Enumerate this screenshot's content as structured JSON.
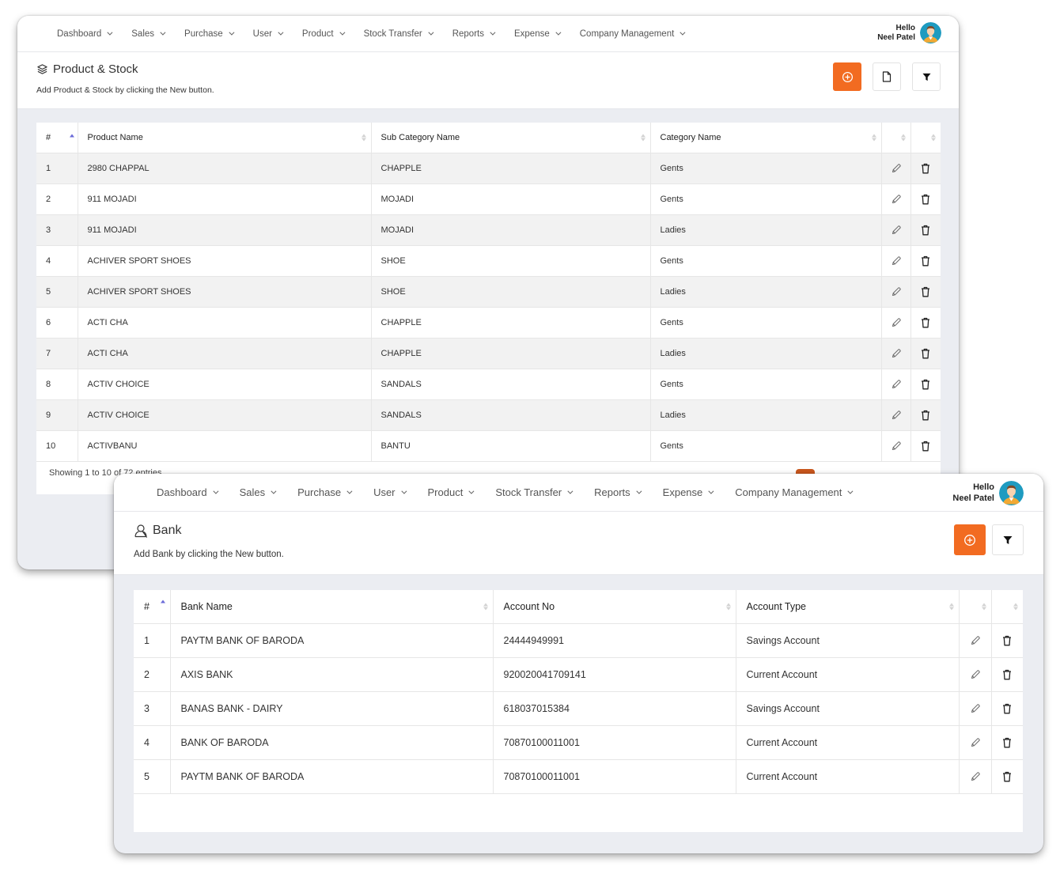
{
  "windows": {
    "product": {
      "nav": {
        "items": [
          {
            "label": "Dashboard"
          },
          {
            "label": "Sales"
          },
          {
            "label": "Purchase"
          },
          {
            "label": "User"
          },
          {
            "label": "Product"
          },
          {
            "label": "Stock Transfer"
          },
          {
            "label": "Reports"
          },
          {
            "label": "Expense"
          },
          {
            "label": "Company Management"
          }
        ],
        "user": {
          "greeting": "Hello",
          "name": "Neel Patel"
        }
      },
      "header": {
        "title": "Product & Stock",
        "title_icon": "layers-icon",
        "subtitle": "Add Product & Stock by clicking the New button.",
        "actions": [
          {
            "name": "new-button",
            "icon": "plus-circle-icon"
          },
          {
            "name": "export-button",
            "icon": "document-icon"
          },
          {
            "name": "filter-button",
            "icon": "filter-icon"
          }
        ]
      },
      "table": {
        "columns": [
          "#",
          "Product Name",
          "Sub Category Name",
          "Category Name",
          "",
          ""
        ],
        "rows": [
          {
            "no": "1",
            "product": "2980 CHAPPAL",
            "sub_category": "CHAPPLE",
            "category": "Gents"
          },
          {
            "no": "2",
            "product": "911 MOJADI",
            "sub_category": "MOJADI",
            "category": "Gents"
          },
          {
            "no": "3",
            "product": "911 MOJADI",
            "sub_category": "MOJADI",
            "category": "Ladies"
          },
          {
            "no": "4",
            "product": "ACHIVER SPORT SHOES",
            "sub_category": "SHOE",
            "category": "Gents"
          },
          {
            "no": "5",
            "product": "ACHIVER SPORT SHOES",
            "sub_category": "SHOE",
            "category": "Ladies"
          },
          {
            "no": "6",
            "product": "ACTI CHA",
            "sub_category": "CHAPPLE",
            "category": "Gents"
          },
          {
            "no": "7",
            "product": "ACTI CHA",
            "sub_category": "CHAPPLE",
            "category": "Ladies"
          },
          {
            "no": "8",
            "product": "ACTIV CHOICE",
            "sub_category": "SANDALS",
            "category": "Gents"
          },
          {
            "no": "9",
            "product": "ACTIV CHOICE",
            "sub_category": "SANDALS",
            "category": "Ladies"
          },
          {
            "no": "10",
            "product": "ACTIVBANU",
            "sub_category": "BANTU",
            "category": "Gents"
          }
        ],
        "footer": "Showing 1 to 10 of 72 entries"
      }
    },
    "bank": {
      "nav": {
        "items": [
          {
            "label": "Dashboard"
          },
          {
            "label": "Sales"
          },
          {
            "label": "Purchase"
          },
          {
            "label": "User"
          },
          {
            "label": "Product"
          },
          {
            "label": "Stock Transfer"
          },
          {
            "label": "Reports"
          },
          {
            "label": "Expense"
          },
          {
            "label": "Company Management"
          }
        ],
        "user": {
          "greeting": "Hello",
          "name": "Neel Patel"
        }
      },
      "header": {
        "title": "Bank",
        "title_icon": "user-icon",
        "subtitle": "Add Bank by clicking the New button.",
        "actions": [
          {
            "name": "new-button",
            "icon": "plus-circle-icon"
          },
          {
            "name": "filter-button",
            "icon": "filter-icon"
          }
        ]
      },
      "table": {
        "columns": [
          "#",
          "Bank Name",
          "Account No",
          "Account Type",
          "",
          ""
        ],
        "rows": [
          {
            "no": "1",
            "bank": "PAYTM BANK OF BARODA",
            "account_no": "24444949991",
            "type": "Savings Account"
          },
          {
            "no": "2",
            "bank": "AXIS BANK",
            "account_no": "920020041709141",
            "type": "Current Account"
          },
          {
            "no": "3",
            "bank": "BANAS BANK - DAIRY",
            "account_no": "618037015384",
            "type": "Savings Account"
          },
          {
            "no": "4",
            "bank": "BANK OF BARODA",
            "account_no": "70870100011001",
            "type": "Current Account"
          },
          {
            "no": "5",
            "bank": "PAYTM BANK OF BARODA",
            "account_no": "70870100011001",
            "type": "Current Account"
          }
        ]
      }
    }
  },
  "colors": {
    "accent": "#f26b21",
    "page_bg": "#ebedf2",
    "sort_active": "#6a6ad8",
    "row_stripe": "#f2f2f2"
  }
}
